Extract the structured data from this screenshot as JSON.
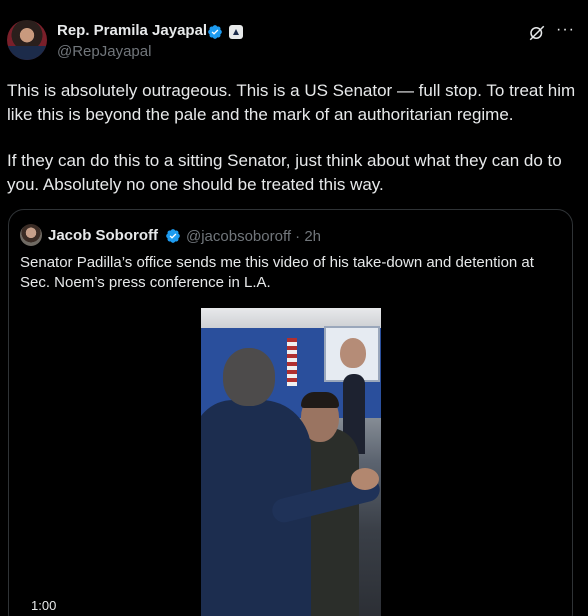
{
  "post": {
    "author_name": "Rep. Pramila Jayapal",
    "author_handle": "@RepJayapal",
    "paragraphs": [
      "This is absolutely outrageous. This is a US Senator — full stop. To treat him like this is beyond the pale and the mark of an authoritarian regime.",
      "If they can do this to a sitting Senator, just think about what they can do to you. Absolutely no one should be treated this way."
    ],
    "more_label": "···"
  },
  "quote": {
    "author_name": "Jacob Soboroff",
    "handle_time": "@jacobsoboroff · 2h",
    "text": "Senator Padilla’s office sends me this video of his take-down and detention at Sec. Noem’s press conference in L.A.",
    "video_timestamp": "1:00"
  },
  "icons": {
    "verified": "verified-badge-icon",
    "affiliation": "government-affiliation-icon",
    "grok": "grok-icon",
    "more": "more-icon"
  },
  "colors": {
    "background": "#000000",
    "text_primary": "#e7e9ea",
    "text_secondary": "#71767b",
    "verified_blue": "#1d9bf0",
    "border": "#2f3336"
  }
}
